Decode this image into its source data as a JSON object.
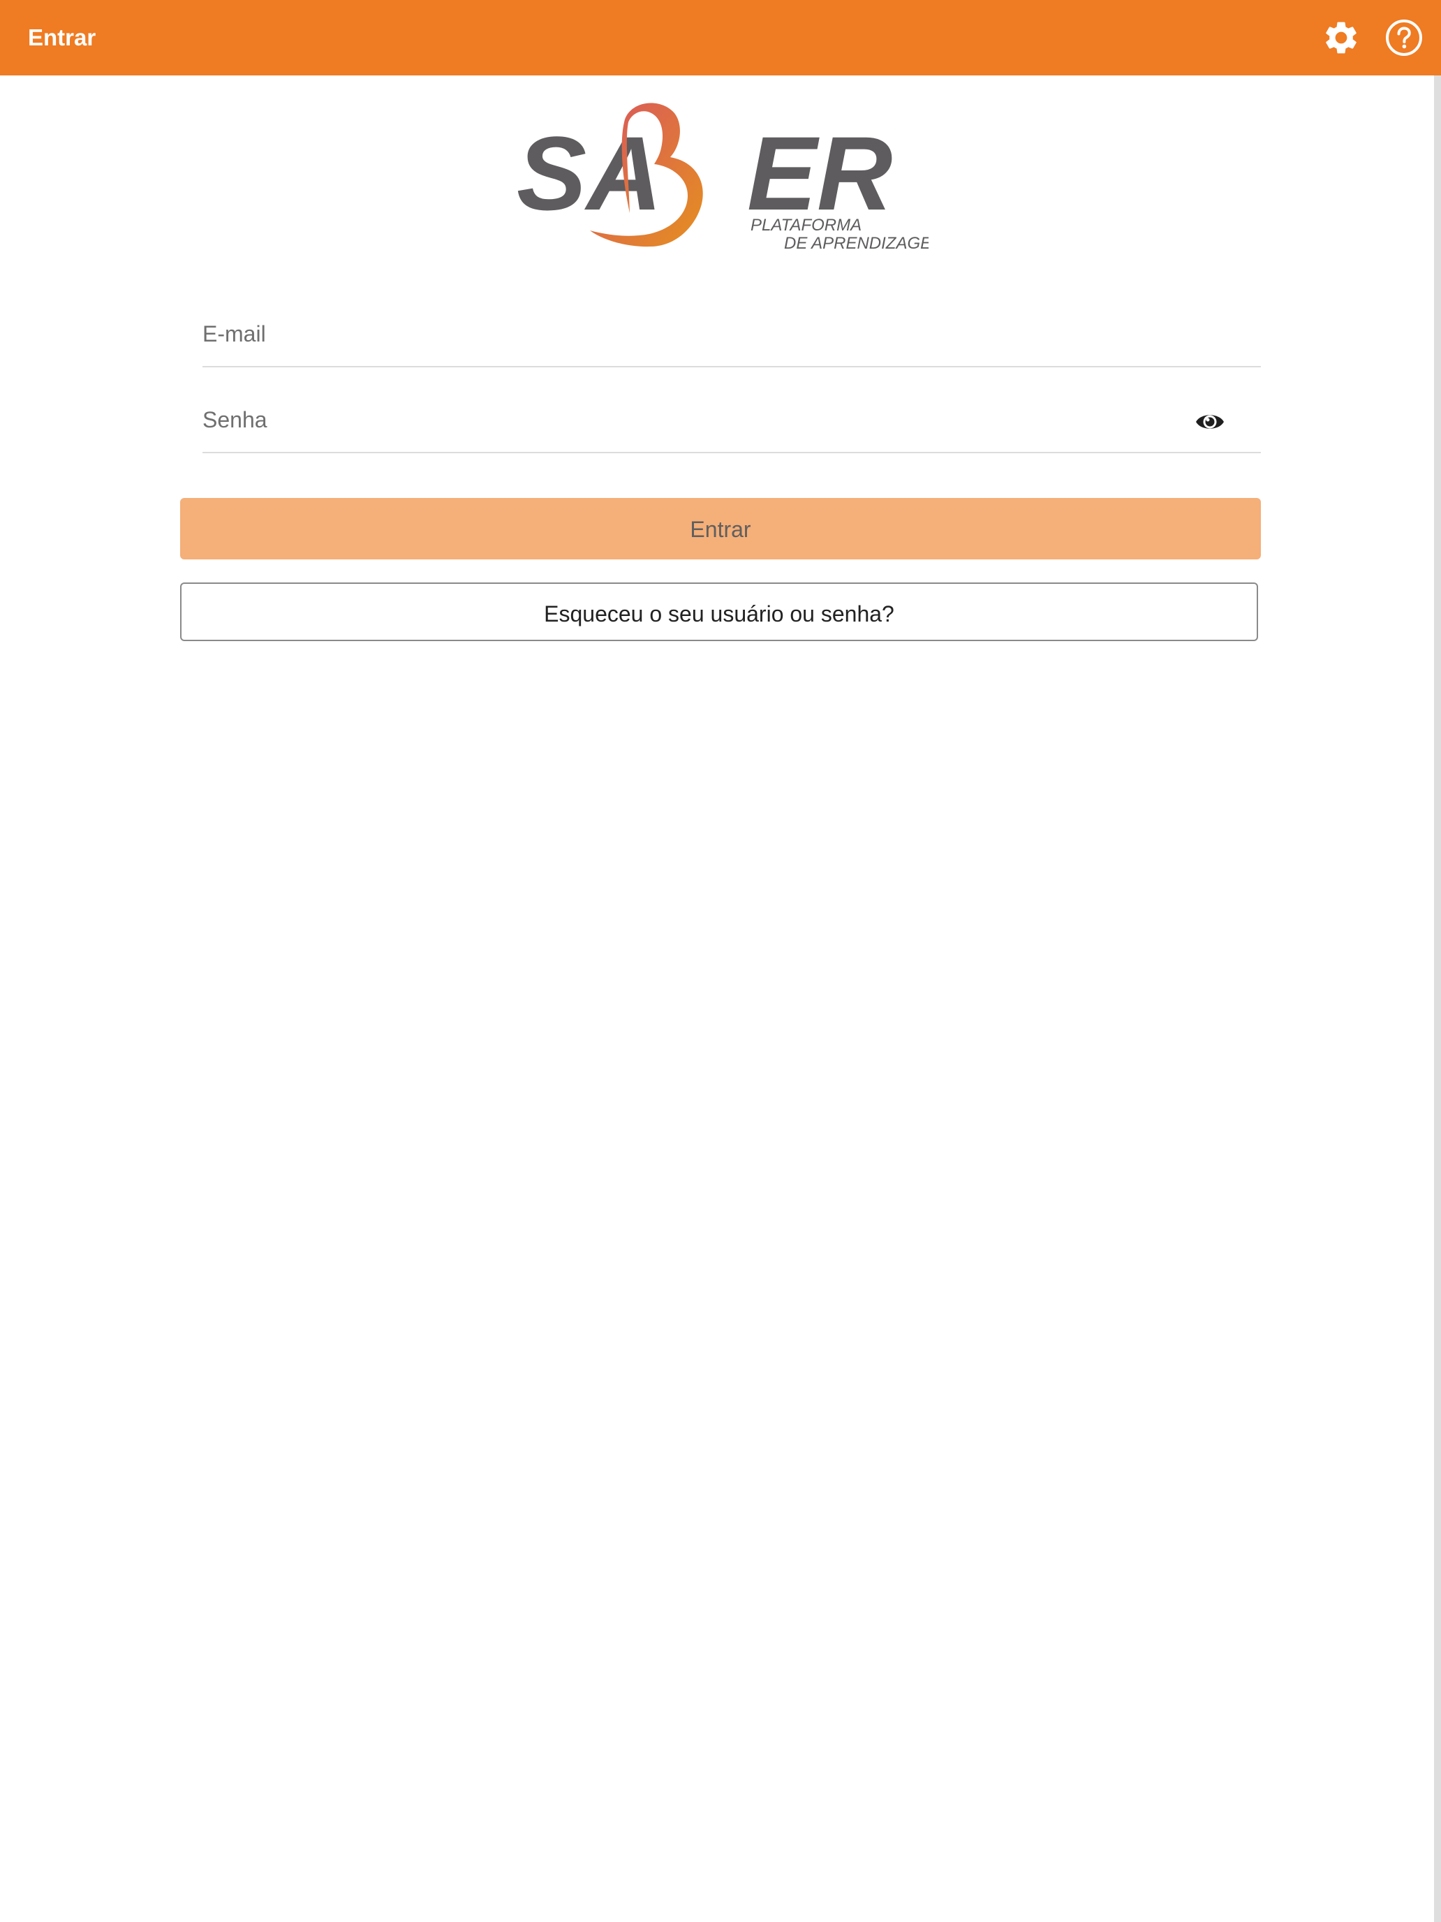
{
  "header": {
    "title": "Entrar",
    "icons": [
      "gear-icon",
      "help-icon"
    ]
  },
  "logo": {
    "wordmark_left": "SA",
    "wordmark_right": "ER",
    "tagline_line1": "PLATAFORMA",
    "tagline_line2": "DE APRENDIZAGEM"
  },
  "form": {
    "email_placeholder": "E-mail",
    "email_value": "",
    "password_placeholder": "Senha",
    "password_value": "",
    "submit_label": "Entrar",
    "forgot_label": "Esqueceu o seu usuário ou senha?"
  },
  "colors": {
    "header": "#ef7b22",
    "submit_button": "#f5af79",
    "logo_gray": "#5e5c5e",
    "heart_start": "#d8555f",
    "heart_end": "#e5901f"
  }
}
